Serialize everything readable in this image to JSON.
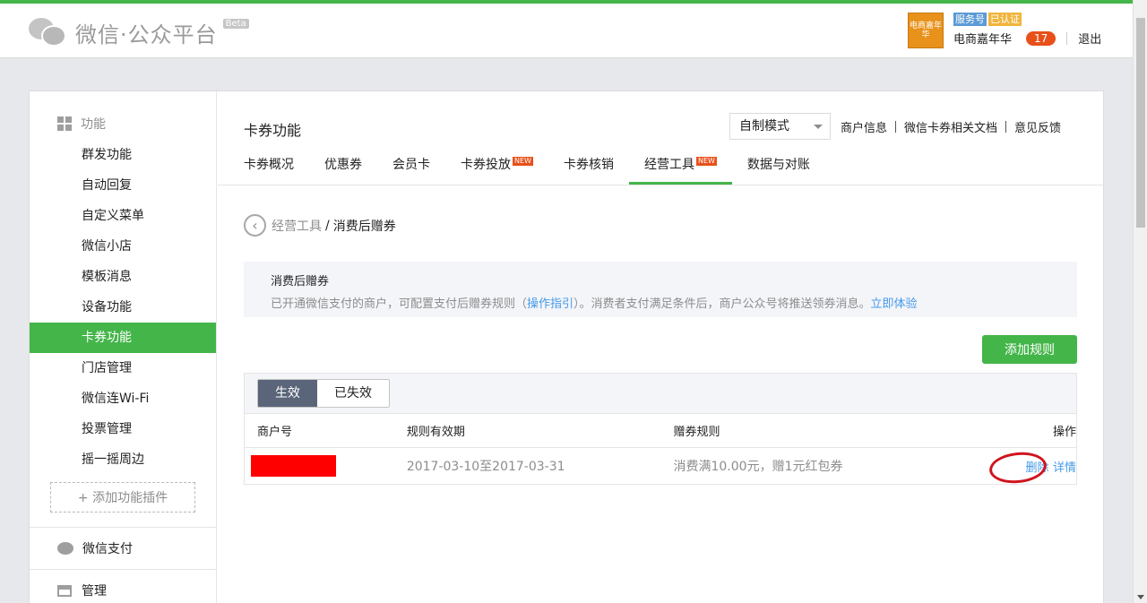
{
  "header": {
    "logo_text": "微信·公众平台",
    "beta": "Beta",
    "avatar_text": "电商嘉年华",
    "tags": [
      "服务号",
      "已认证"
    ],
    "account_name": "电商嘉年华",
    "badge_count": "17",
    "logout": "退出"
  },
  "sidebar": {
    "section_title": "功能",
    "items": [
      "群发功能",
      "自动回复",
      "自定义菜单",
      "微信小店",
      "模板消息",
      "设备功能",
      "卡券功能",
      "门店管理",
      "微信连Wi-Fi",
      "投票管理",
      "摇一摇周边"
    ],
    "active_index": 6,
    "add_plugin": "+ 添加功能插件",
    "pay": "微信支付",
    "manage": "管理"
  },
  "main": {
    "title": "卡券功能",
    "mode": "自制模式",
    "top_links": [
      "商户信息",
      "微信卡券相关文档",
      "意见反馈"
    ],
    "tabs": [
      {
        "label": "卡券概况",
        "new": ""
      },
      {
        "label": "优惠券",
        "new": ""
      },
      {
        "label": "会员卡",
        "new": ""
      },
      {
        "label": "卡券投放",
        "new": "NEW"
      },
      {
        "label": "卡券核销",
        "new": ""
      },
      {
        "label": "经营工具",
        "new": "NEW"
      },
      {
        "label": "数据与对账",
        "new": ""
      }
    ],
    "breadcrumb": {
      "parent": "经营工具",
      "sep": "/",
      "current": "消费后赠券"
    },
    "info": {
      "title": "消费后赠券",
      "desc_1": "已开通微信支付的商户，可配置支付后赠券规则（",
      "link_guide": "操作指引",
      "desc_2": "）。消费者支付满足条件后，商户公众号将推送领券消息。",
      "link_try": "立即体验"
    },
    "add_rule": "添加规则",
    "filters": [
      "生效",
      "已失效"
    ],
    "columns": [
      "商户号",
      "规则有效期",
      "赠券规则",
      "操作"
    ],
    "rows": [
      {
        "validity": "2017-03-10至2017-03-31",
        "rule": "消费满10.00元，赠1元红包券",
        "ops": [
          "删除",
          "详情"
        ]
      }
    ]
  }
}
